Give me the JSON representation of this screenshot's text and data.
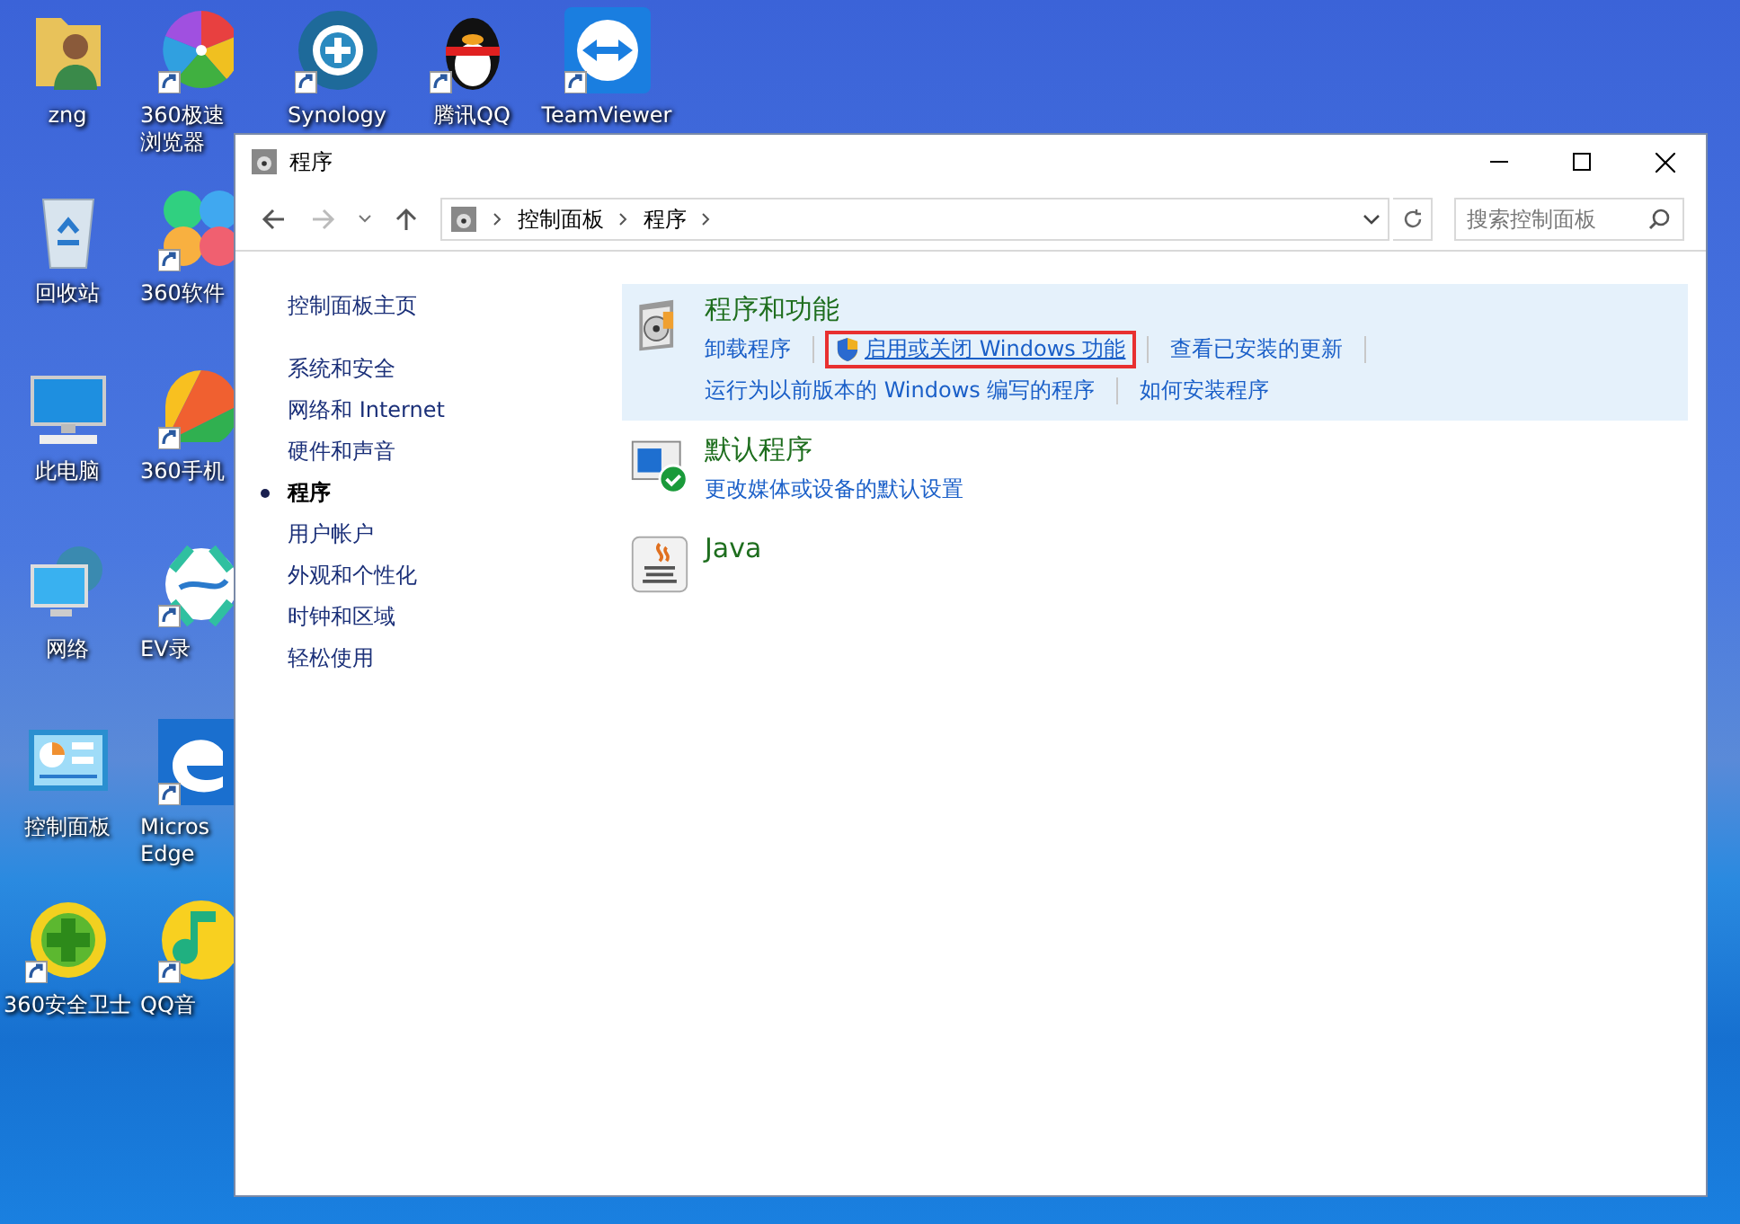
{
  "desktop": {
    "columns": [
      [
        {
          "label": "zng",
          "kind": "user-folder",
          "shortcut": false
        },
        {
          "label": "回收站",
          "kind": "recycle-bin",
          "shortcut": false
        },
        {
          "label": "此电脑",
          "kind": "computer",
          "shortcut": false
        },
        {
          "label": "网络",
          "kind": "network",
          "shortcut": false
        },
        {
          "label": "控制面板",
          "kind": "control-panel",
          "shortcut": false
        },
        {
          "label": "360安全卫士",
          "kind": "security",
          "shortcut": true
        }
      ],
      [
        {
          "label": "360极速浏览器",
          "kind": "pinwheel",
          "shortcut": true
        },
        {
          "label": "360软件",
          "kind": "petals",
          "shortcut": true
        },
        {
          "label": "360手机",
          "kind": "fan",
          "shortcut": true
        },
        {
          "label": "EV录",
          "kind": "ev",
          "shortcut": true
        },
        {
          "label": "Micros Edge",
          "kind": "edge",
          "shortcut": true
        },
        {
          "label": "QQ音",
          "kind": "music",
          "shortcut": true
        }
      ],
      [
        {
          "label": "Synology",
          "kind": "synology",
          "shortcut": true
        }
      ],
      [
        {
          "label": "腾讯QQ",
          "kind": "penguin",
          "shortcut": true
        }
      ],
      [
        {
          "label": "TeamViewer",
          "kind": "teamviewer",
          "shortcut": true
        }
      ]
    ]
  },
  "window": {
    "title": "程序",
    "address": {
      "breadcrumb": [
        "控制面板",
        "程序"
      ],
      "search_placeholder": "搜索控制面板"
    },
    "sidebar": {
      "home": "控制面板主页",
      "items": [
        {
          "label": "系统和安全",
          "selected": false
        },
        {
          "label": "网络和 Internet",
          "selected": false
        },
        {
          "label": "硬件和声音",
          "selected": false
        },
        {
          "label": "程序",
          "selected": true
        },
        {
          "label": "用户帐户",
          "selected": false
        },
        {
          "label": "外观和个性化",
          "selected": false
        },
        {
          "label": "时钟和区域",
          "selected": false
        },
        {
          "label": "轻松使用",
          "selected": false
        }
      ]
    },
    "categories": [
      {
        "title": "程序和功能",
        "kind": "programs",
        "selected": true,
        "link_rows": [
          [
            {
              "text": "卸载程序",
              "shield": false,
              "highlighted": false
            },
            {
              "text": "启用或关闭 Windows 功能",
              "shield": true,
              "highlighted": true
            },
            {
              "text": "查看已安装的更新",
              "shield": false,
              "highlighted": false
            }
          ],
          [
            {
              "text": "运行为以前版本的 Windows 编写的程序",
              "shield": false,
              "highlighted": false
            },
            {
              "text": "如何安装程序",
              "shield": false,
              "highlighted": false
            }
          ]
        ]
      },
      {
        "title": "默认程序",
        "kind": "defaults",
        "selected": false,
        "link_rows": [
          [
            {
              "text": "更改媒体或设备的默认设置",
              "shield": false,
              "highlighted": false
            }
          ]
        ]
      },
      {
        "title": "Java",
        "kind": "java",
        "selected": false
      }
    ]
  }
}
